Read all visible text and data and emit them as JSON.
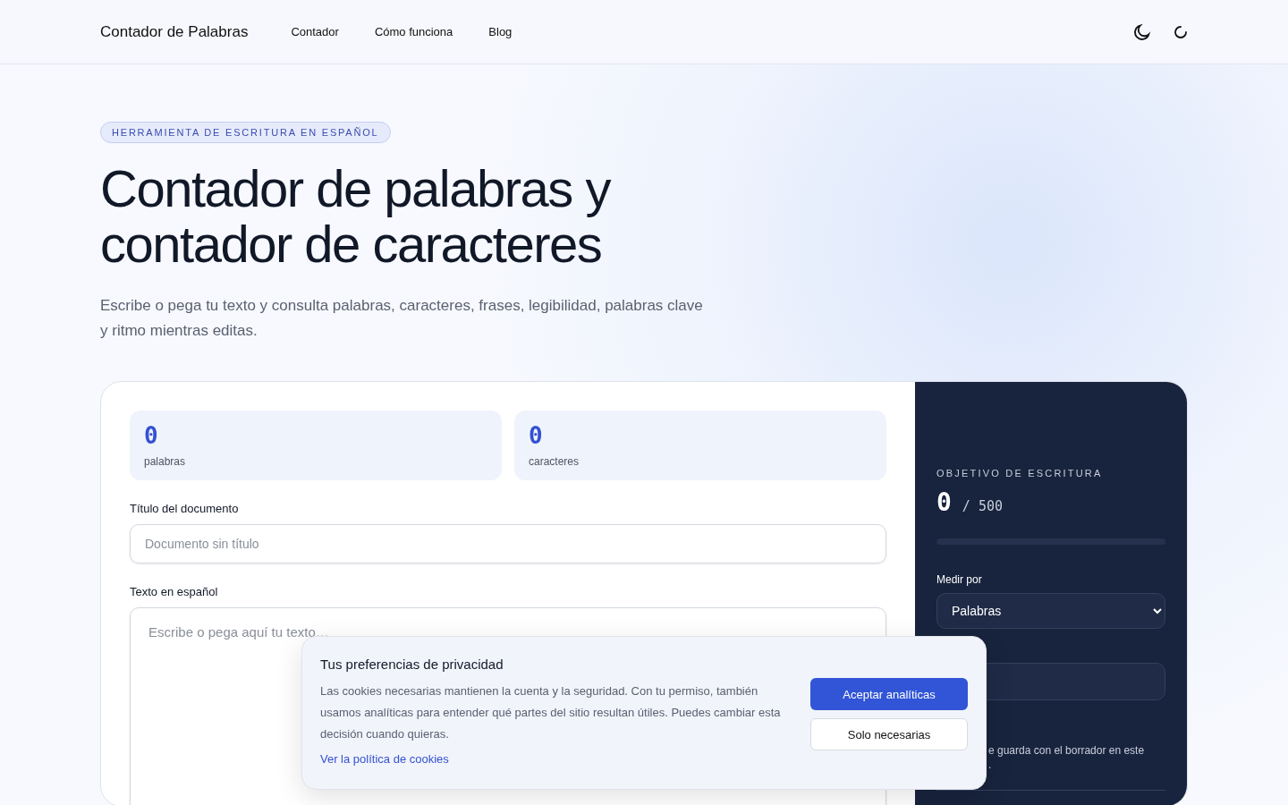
{
  "header": {
    "brand": "Contador de Palabras",
    "nav": [
      {
        "label": "Contador"
      },
      {
        "label": "Cómo funciona"
      },
      {
        "label": "Blog"
      }
    ]
  },
  "hero": {
    "badge": "HERRAMIENTA DE ESCRITURA EN ESPAÑOL",
    "title": "Contador de palabras y contador de caracteres",
    "subtitle": "Escribe o pega tu texto y consulta palabras, caracteres, frases, legibilidad, palabras clave y ritmo mientras editas."
  },
  "stats": [
    {
      "value": "0",
      "label": "palabras"
    },
    {
      "value": "0",
      "label": "caracteres"
    }
  ],
  "title_field": {
    "label": "Título del documento",
    "placeholder": "Documento sin título"
  },
  "text_field": {
    "label": "Texto en español",
    "placeholder": "Escribe o pega aquí tu texto…"
  },
  "goal": {
    "heading": "OBJETIVO DE ESCRITURA",
    "current": "0",
    "target": "/ 500",
    "level": 0,
    "measure_label": "Medir por",
    "measure_value": "Palabras",
    "note_lines": [
      "e guarda con el borrador en este",
      "."
    ]
  },
  "cookie_banner": {
    "title": "Tus preferencias de privacidad",
    "text": "Las cookies necesarias mantienen la cuenta y la seguridad. Con tu permiso, también usamos analíticas para entender qué partes del sitio resultan útiles. Puedes cambiar esta decisión cuando quieras.",
    "link": "Ver la política de cookies",
    "buttons": [
      {
        "label": "Aceptar analíticas",
        "kind": "primary"
      },
      {
        "label": "Solo necesarias",
        "kind": "secondary"
      }
    ]
  }
}
